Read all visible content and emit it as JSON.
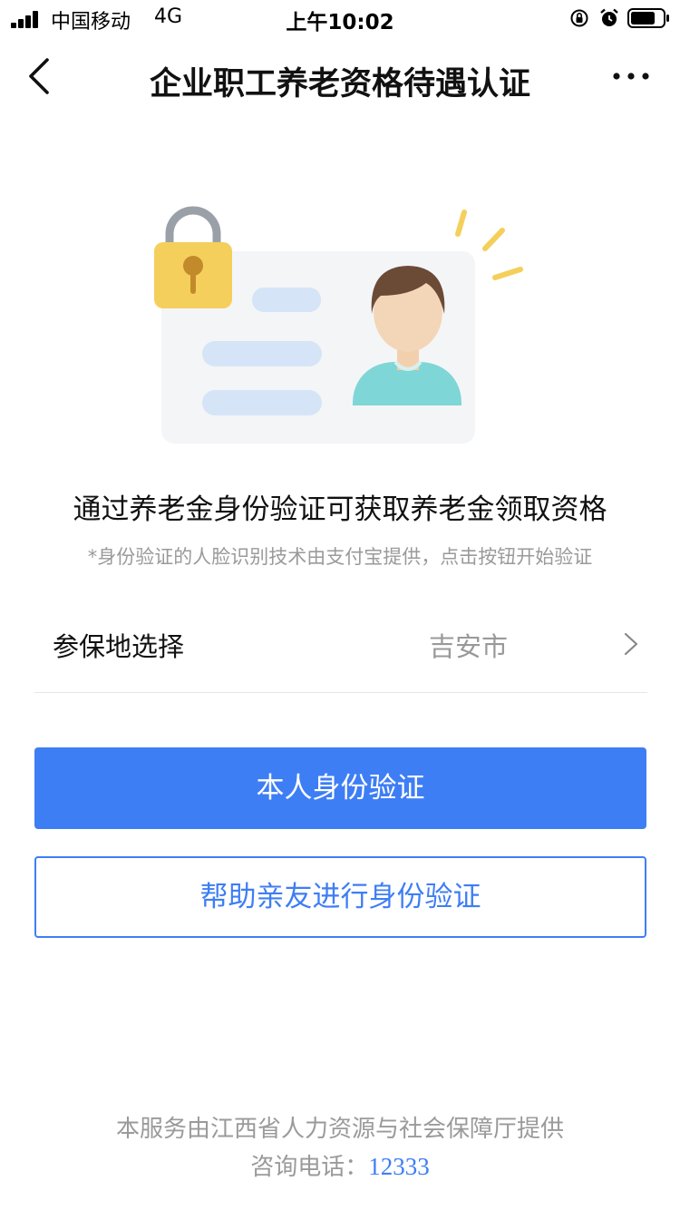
{
  "status_bar": {
    "carrier": "中国移动",
    "network": "4G",
    "time": "上午10:02",
    "icons": [
      "signal-icon",
      "orientation-lock-icon",
      "alarm-icon",
      "battery-icon"
    ]
  },
  "nav": {
    "title": "企业职工养老资格待遇认证",
    "back_icon": "chevron-left-icon",
    "more_icon": "more-dots-icon"
  },
  "hero": {
    "icon": "id-card-with-lock-illustration"
  },
  "intro": {
    "headline": "通过养老金身份验证可获取养老金领取资格",
    "note": "*身份验证的人脸识别技术由支付宝提供，点击按钮开始验证"
  },
  "region": {
    "label": "参保地选择",
    "value": "吉安市",
    "chevron_icon": "chevron-right-icon"
  },
  "actions": {
    "self_verify": "本人身份验证",
    "help_verify": "帮助亲友进行身份验证"
  },
  "footer": {
    "provider": "本服务由江西省人力资源与社会保障厅提供",
    "phone_label": "咨询电话：",
    "phone_number": "12333"
  },
  "colors": {
    "accent": "#3e7ef5",
    "lock": "#f5cf5c",
    "avatar_shirt": "#7fd6d6",
    "card_lines": "#d6e4f7"
  }
}
